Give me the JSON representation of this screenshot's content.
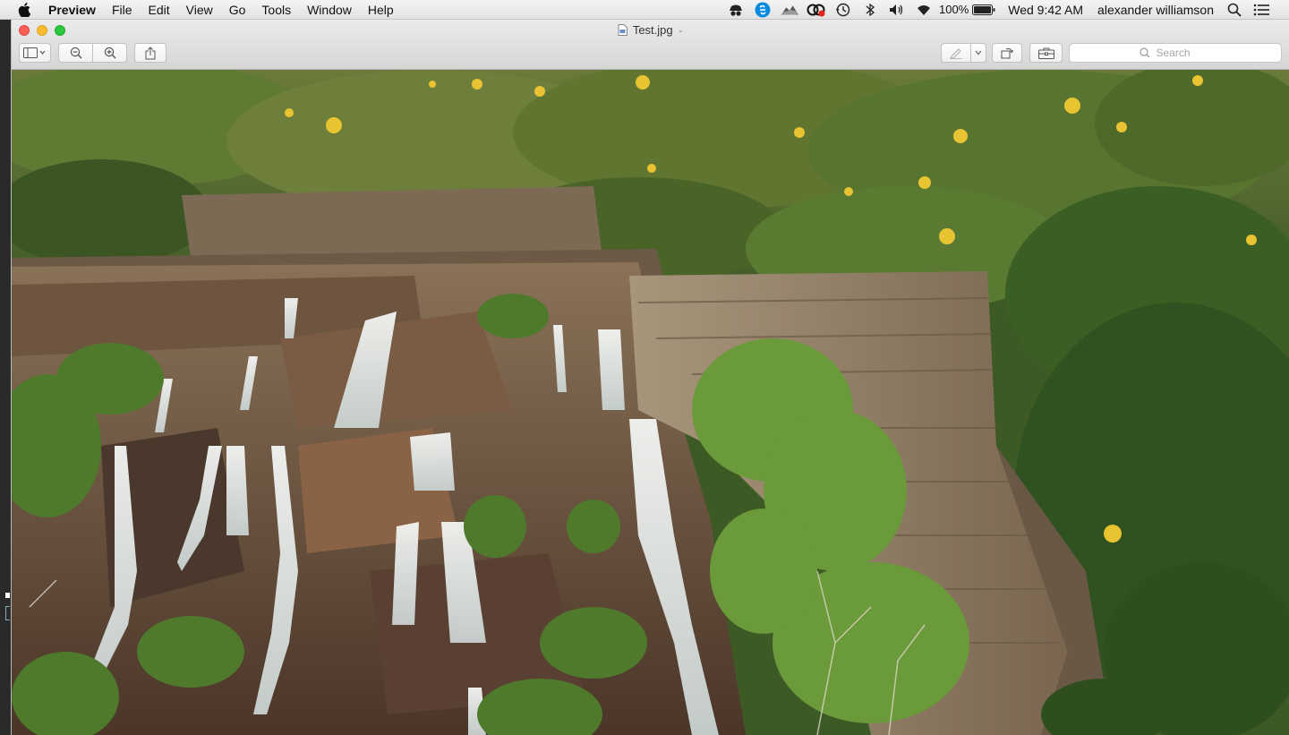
{
  "menubar": {
    "app_name": "Preview",
    "items": [
      "File",
      "Edit",
      "View",
      "Go",
      "Tools",
      "Window",
      "Help"
    ],
    "battery_percent": "100%",
    "datetime": "Wed 9:42 AM",
    "user": "alexander williamson"
  },
  "window": {
    "title": "Test.jpg",
    "search_placeholder": "Search"
  },
  "colors": {
    "close": "#fc5f57",
    "minimize": "#fdbc2e",
    "maximize": "#2ac840"
  }
}
